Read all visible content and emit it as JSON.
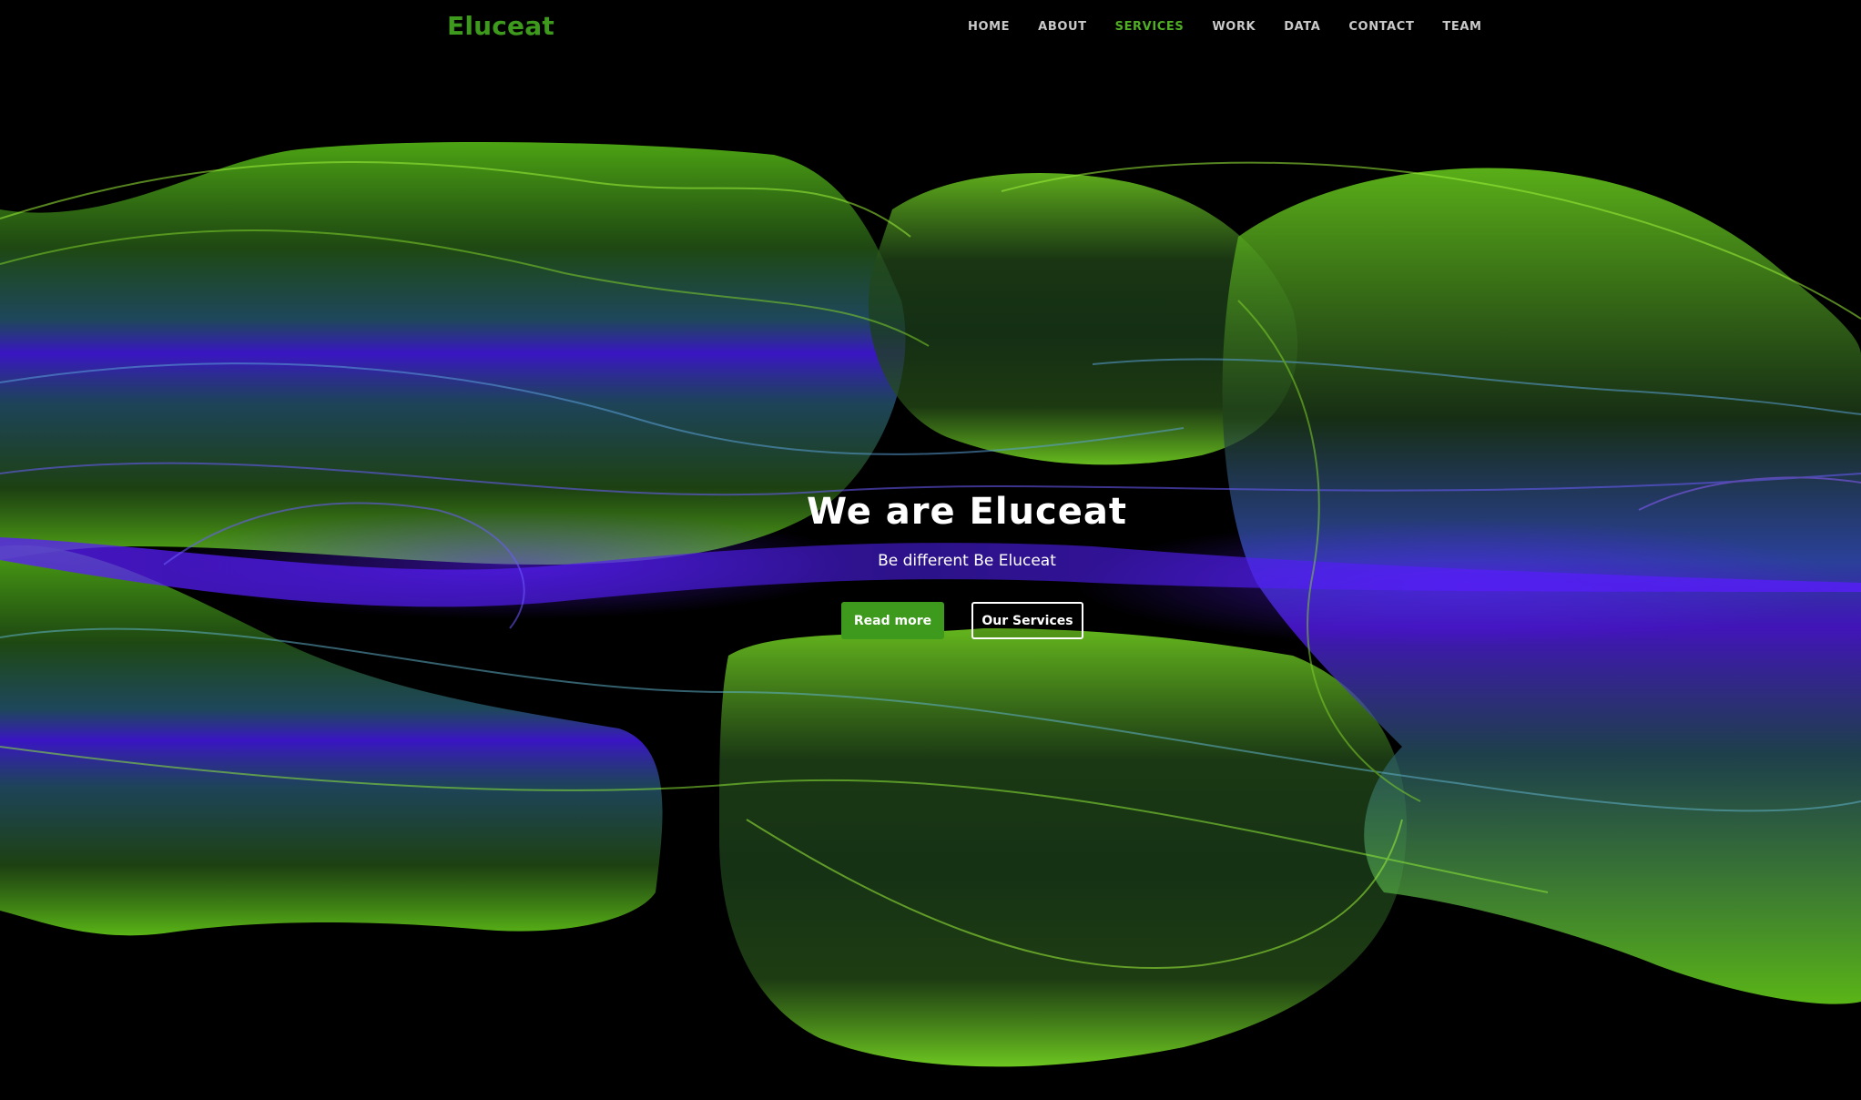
{
  "brand": {
    "name": "Eluceat"
  },
  "nav": {
    "items": [
      {
        "label": "HOME",
        "active": false
      },
      {
        "label": "ABOUT",
        "active": false
      },
      {
        "label": "SERVICES",
        "active": true
      },
      {
        "label": "WORK",
        "active": false
      },
      {
        "label": "DATA",
        "active": false
      },
      {
        "label": "CONTACT",
        "active": false
      },
      {
        "label": "TEAM",
        "active": false
      }
    ]
  },
  "hero": {
    "title": "We are Eluceat",
    "subtitle": "Be different Be Eluceat",
    "primary_button": "Read more",
    "secondary_button": "Our Services"
  },
  "colors": {
    "background": "#000000",
    "accent": "#3d9a1c",
    "nav_active": "#4fae24",
    "wave_green": "#6fe01c",
    "wave_blue": "#4a8fcf",
    "wave_violet": "#5a1cff"
  }
}
